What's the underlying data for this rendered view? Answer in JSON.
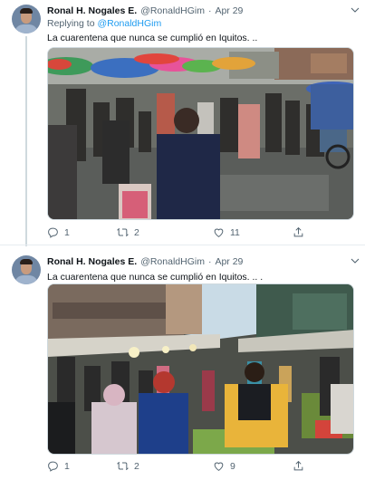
{
  "tweets": [
    {
      "author_name": "Ronal H. Nogales E.",
      "handle": "@RonaldHGim",
      "separator": "·",
      "date": "Apr 29",
      "replying_prefix": "Replying to",
      "replying_handle": "@RonaldHGim",
      "text": "La cuarentena que nunca se cumplió en Iquitos. ..",
      "photo_icon": "street-market-photo",
      "counts": {
        "reply": "1",
        "retweet": "2",
        "like": "11",
        "share": ""
      }
    },
    {
      "author_name": "Ronal H. Nogales E.",
      "handle": "@RonaldHGim",
      "separator": "·",
      "date": "Apr 29",
      "text": "La cuarentena que nunca se cumplió en Iquitos. .. .",
      "photo_icon": "crowded-market-photo",
      "counts": {
        "reply": "1",
        "retweet": "2",
        "like": "9",
        "share": ""
      }
    }
  ],
  "icons": {
    "more": "chevron-down-icon",
    "reply": "reply-icon",
    "retweet": "retweet-icon",
    "like": "heart-icon",
    "share": "share-icon"
  },
  "colors": {
    "link": "#1d9bf0",
    "muted": "#536471",
    "text": "#0f1419",
    "border": "#cfd9de"
  }
}
